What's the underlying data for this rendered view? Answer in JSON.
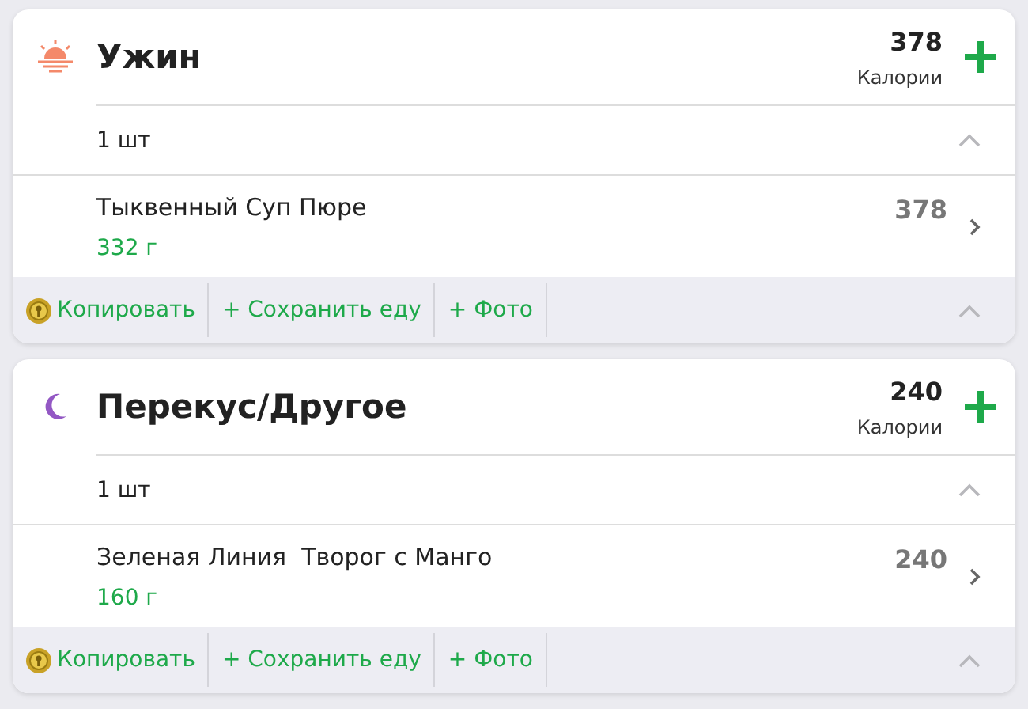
{
  "meals": [
    {
      "kind": "dinner",
      "title": "Ужин",
      "calories": "378",
      "calories_label": "Калории",
      "serving": {
        "label": "1 шт",
        "expanded": true
      },
      "foods": [
        {
          "name": "Тыквенный Суп Пюре",
          "amount": "332 г",
          "calories": "378"
        }
      ],
      "actions": [
        "Копировать",
        "+ Сохранить еду",
        "+ Фото"
      ],
      "actions_expanded": true
    },
    {
      "kind": "snack",
      "title": "Перекус/Другое",
      "calories": "240",
      "calories_label": "Калории",
      "serving": {
        "label": "1 шт",
        "expanded": true
      },
      "foods": [
        {
          "name": "Зеленая Линия  Творог с Манго",
          "amount": "160 г",
          "calories": "240"
        }
      ],
      "actions": [
        "Копировать",
        "+ Сохранить еду",
        "+ Фото"
      ],
      "actions_expanded": true
    }
  ]
}
